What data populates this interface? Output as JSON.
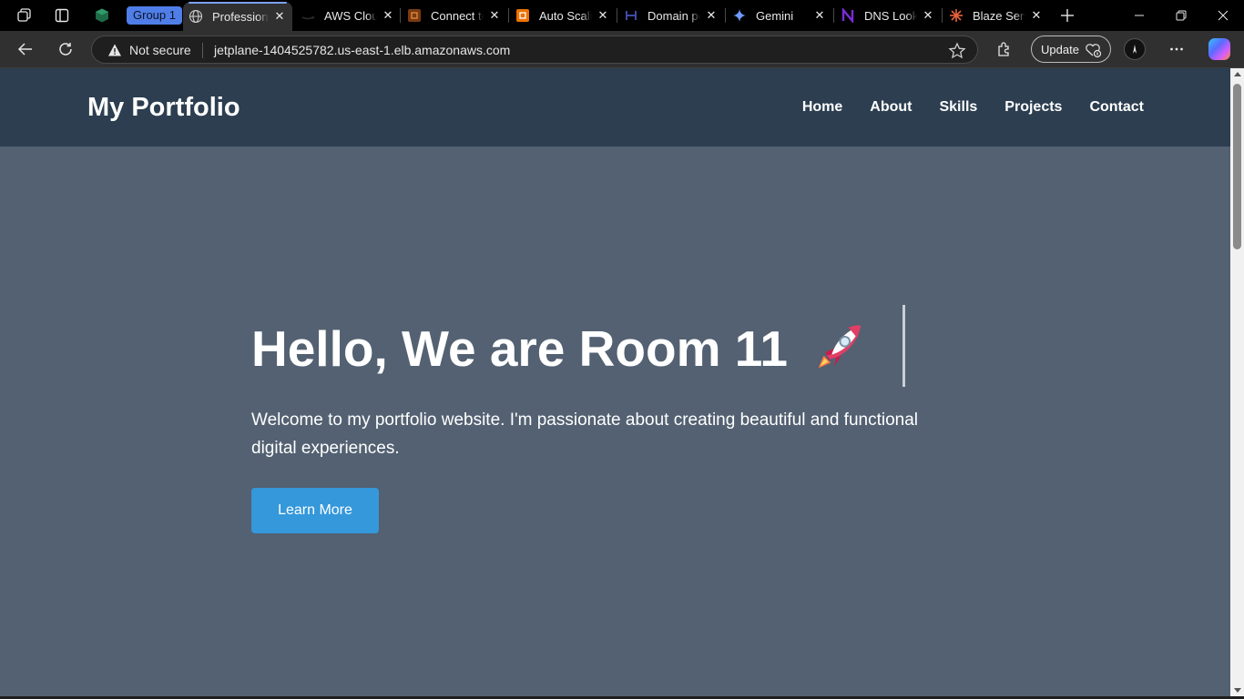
{
  "browser": {
    "group_label": "Group 1",
    "tabs": [
      {
        "title": "Professional Portfolio",
        "icon": "globe-icon",
        "active": true
      },
      {
        "title": "AWS Cloud",
        "icon": "aws-icon"
      },
      {
        "title": "Connect to",
        "icon": "aws-service-icon"
      },
      {
        "title": "Auto Scaling",
        "icon": "aws-ec2-icon"
      },
      {
        "title": "Domain po",
        "icon": "domain-icon"
      },
      {
        "title": "Gemini",
        "icon": "gemini-icon"
      },
      {
        "title": "DNS Lookup",
        "icon": "dns-icon"
      },
      {
        "title": "Blaze Server",
        "icon": "blaze-icon"
      }
    ],
    "address": {
      "security_label": "Not secure",
      "url": "jetplane-1404525782.us-east-1.elb.amazonaws.com"
    },
    "update_label": "Update"
  },
  "site": {
    "brand": "My Portfolio",
    "nav": [
      "Home",
      "About",
      "Skills",
      "Projects",
      "Contact"
    ],
    "hero": {
      "title": "Hello, We are Room 11",
      "emoji": "rocket-icon",
      "text": "Welcome to my portfolio website. I'm passionate about creating beautiful and functional digital experiences.",
      "button": "Learn More"
    },
    "colors": {
      "nav_bg": "#2c3e50",
      "hero_bg": "#536172",
      "button": "#3498db"
    }
  }
}
